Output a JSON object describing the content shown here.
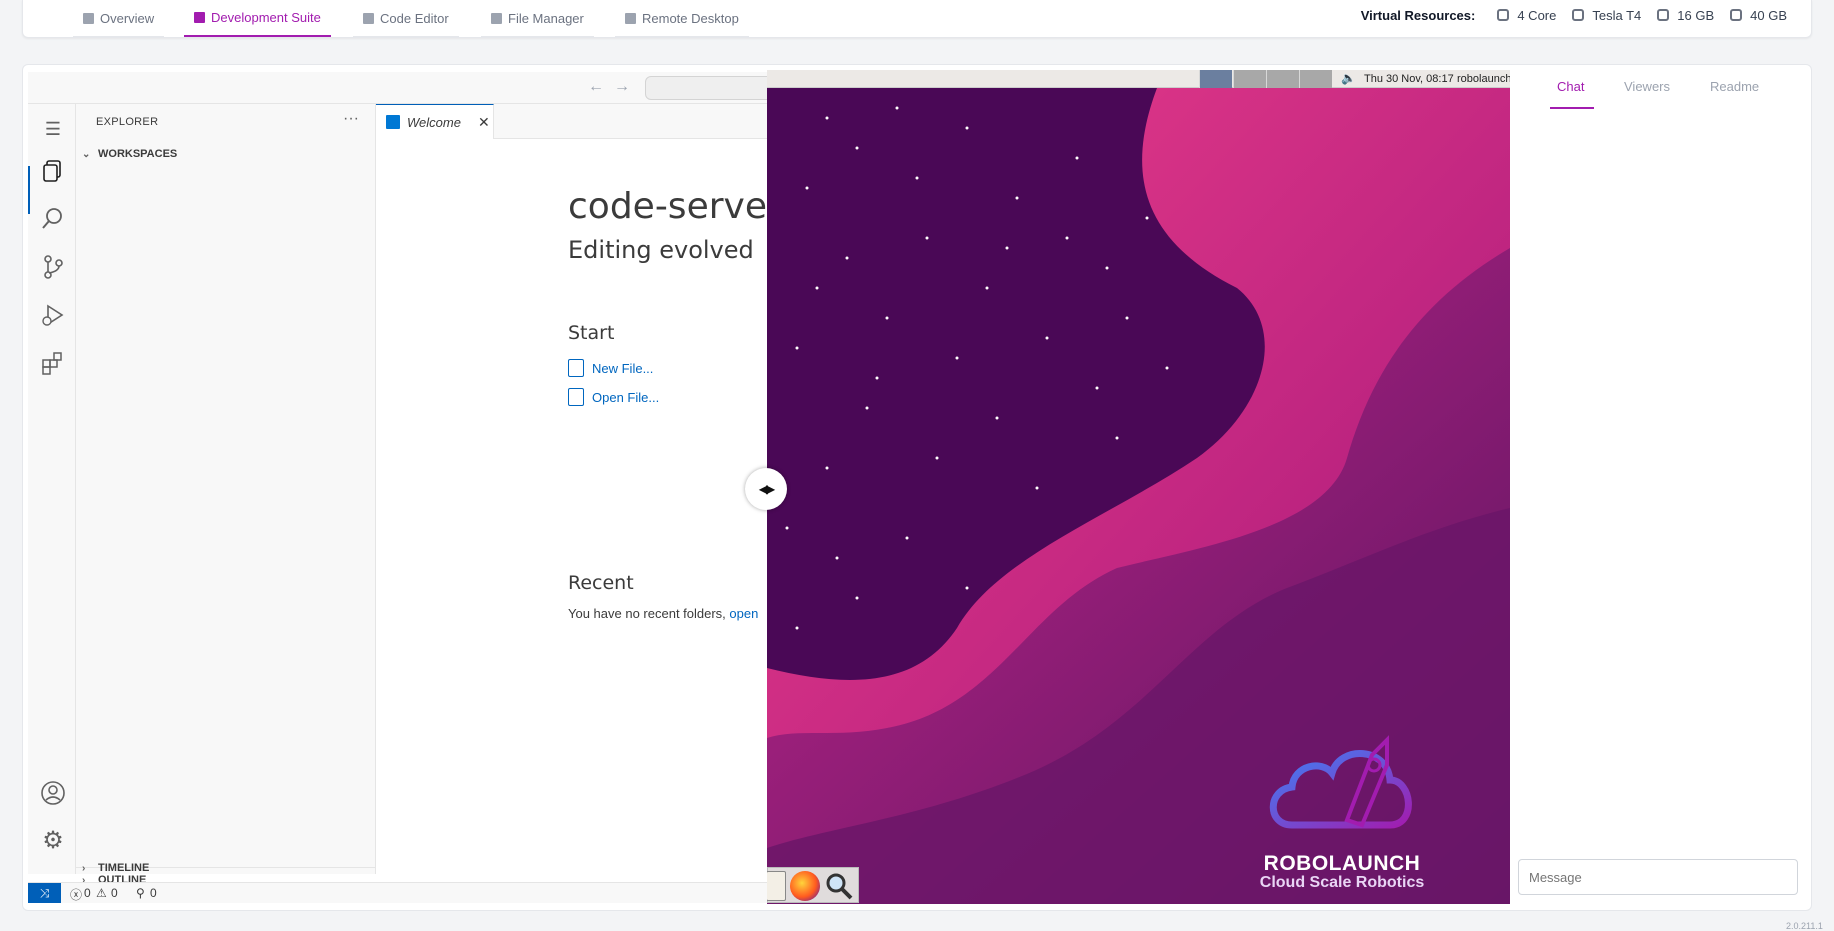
{
  "topbar": {
    "tabs": [
      {
        "label": "Overview"
      },
      {
        "label": "Development Suite"
      },
      {
        "label": "Code Editor"
      },
      {
        "label": "File Manager"
      },
      {
        "label": "Remote Desktop"
      }
    ],
    "active_tab": "Development Suite",
    "resources_label": "Virtual Resources:",
    "resources": [
      {
        "icon": "cpu-icon",
        "value": "4 Core"
      },
      {
        "icon": "gpu-icon",
        "value": "Tesla T4"
      },
      {
        "icon": "memory-icon",
        "value": "16 GB"
      },
      {
        "icon": "storage-icon",
        "value": "40 GB"
      }
    ]
  },
  "colors": {
    "accent": "#a21caf",
    "vscode_blue": "#005fb8",
    "link": "#0066bf"
  },
  "vscode": {
    "explorer_title": "EXPLORER",
    "sections": {
      "workspaces": "WORKSPACES",
      "outline": "OUTLINE",
      "timeline": "TIMELINE"
    },
    "tab_label": "Welcome",
    "welcome": {
      "title": "code-server",
      "subtitle": "Editing evolved",
      "start_heading": "Start",
      "new_file": "New File...",
      "open_file": "Open File...",
      "recent_heading": "Recent",
      "recent_text": "You have no recent folders,",
      "recent_link": "open"
    },
    "status": {
      "errors": "0",
      "warnings": "0",
      "ports": "0"
    }
  },
  "desktop": {
    "clock": "Thu 30 Nov, 08:17",
    "user": "robolaunch",
    "brand_name": "ROBOLAUNCH",
    "brand_tagline": "Cloud Scale Robotics"
  },
  "right_panel": {
    "tabs": [
      {
        "label": "Chat"
      },
      {
        "label": "Viewers"
      },
      {
        "label": "Readme"
      }
    ],
    "active_tab": "Chat",
    "message_placeholder": "Message"
  },
  "version_text": "2.0.211.1"
}
